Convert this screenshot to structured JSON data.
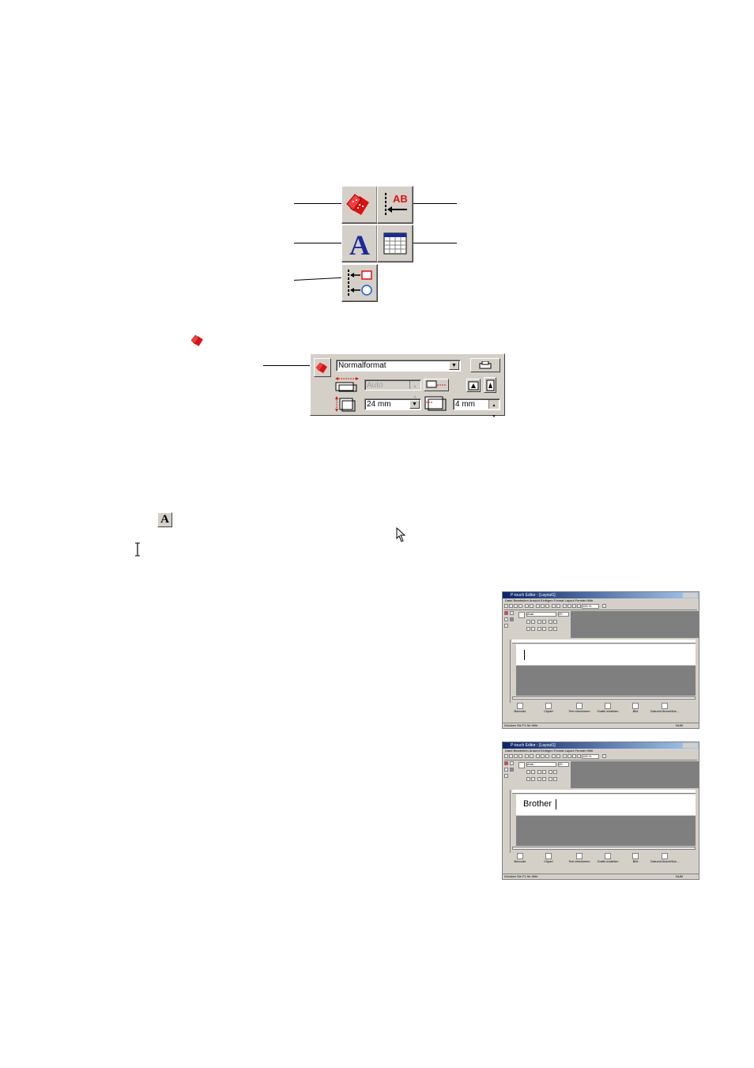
{
  "text_icon_glyph": "A",
  "ab_label": "AB",
  "property_panel": {
    "format_value": "Normalformat",
    "width_value": "Auto",
    "height_value": "24 mm",
    "margin_value": "4 mm"
  },
  "screenshot_1": {
    "title": "P-touch Editor - [Layout1]",
    "menu": "Datei  Bearbeiten  Ansicht  Einfügen  Format  Layout  Fenster  Hilfe",
    "font_name": "Arial",
    "font_size": "20",
    "zoom": "100 %",
    "label_text": "",
    "bottom_buttons": [
      "Barcode",
      "Clipart",
      "Text einrahmen",
      "Grafik erstellen",
      "Bild",
      "Datum/Uhrzeit/Kal..."
    ],
    "status": "Drücken Sie F1 für Hilfe",
    "status_right": "NUM"
  },
  "screenshot_2": {
    "title": "P-touch Editor - [Layout1]",
    "menu": "Datei  Bearbeiten  Ansicht  Einfügen  Format  Layout  Fenster  Hilfe",
    "font_name": "Arial",
    "font_size": "20",
    "zoom": "100 %",
    "label_text": "Brother",
    "bottom_buttons": [
      "Barcode",
      "Clipart",
      "Text einrahmen",
      "Grafik erstellen",
      "Bild",
      "Datum/Uhrzeit/Kal..."
    ],
    "status": "Drücken Sie F1 für Hilfe",
    "status_right": "NUM"
  },
  "colors": {
    "button_face": "#d4d0c8",
    "accent_red": "#e01010",
    "accent_blue": "#1a2a9c",
    "title_bar": "#0a246a"
  },
  "icons": [
    "property-icon",
    "arrange-text-icon",
    "text-icon",
    "table-icon",
    "align-objects-icon",
    "arrow-cursor-icon",
    "ibeam-cursor-icon"
  ]
}
